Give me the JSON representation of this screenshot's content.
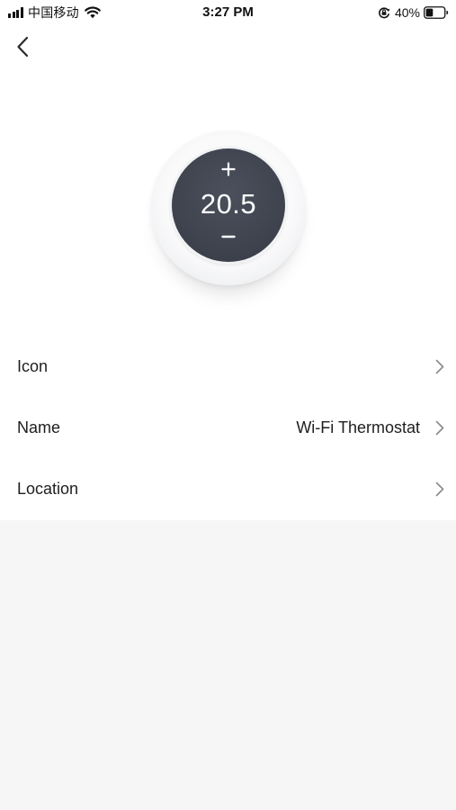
{
  "status_bar": {
    "carrier": "中国移动",
    "time": "3:27 PM",
    "battery_percent": "40%",
    "signal_bars": 4,
    "battery_level": 0.4
  },
  "nav": {
    "back_icon": "chevron-left-icon"
  },
  "thermostat": {
    "temperature": "20.5",
    "increase_icon": "plus-icon",
    "decrease_icon": "minus-icon",
    "face_color": "#40454f"
  },
  "settings": [
    {
      "label": "Icon",
      "value": ""
    },
    {
      "label": "Name",
      "value": "Wi-Fi Thermostat"
    },
    {
      "label": "Location",
      "value": ""
    }
  ],
  "colors": {
    "background": "#f6f6f6",
    "card": "#ffffff",
    "text": "#1e1e1e",
    "chevron": "#8a8a8a"
  }
}
